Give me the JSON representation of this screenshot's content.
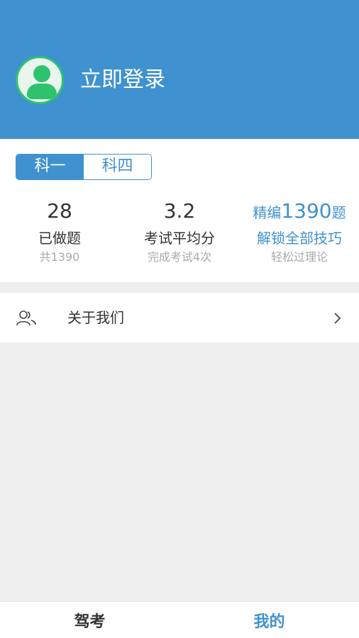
{
  "header": {
    "login_label": "立即登录"
  },
  "subject_tabs": [
    {
      "label": "科一",
      "active": true
    },
    {
      "label": "科四",
      "active": false
    }
  ],
  "stats": {
    "done": {
      "value": "28",
      "label": "已做题",
      "sub": "共1390"
    },
    "avg": {
      "value": "3.2",
      "label": "考试平均分",
      "sub": "完成考试4次"
    },
    "promo": {
      "prefix": "精编",
      "count": "1390",
      "suffix": "题",
      "label": "解锁全部技巧",
      "sub": "轻松过理论"
    }
  },
  "menu": {
    "about_label": "关于我们",
    "icon": "people-icon"
  },
  "tabbar": [
    {
      "label": "驾考",
      "active": false
    },
    {
      "label": "我的",
      "active": true
    }
  ],
  "colors": {
    "accent": "#3f92cf",
    "avatar_green": "#2ec26e"
  }
}
